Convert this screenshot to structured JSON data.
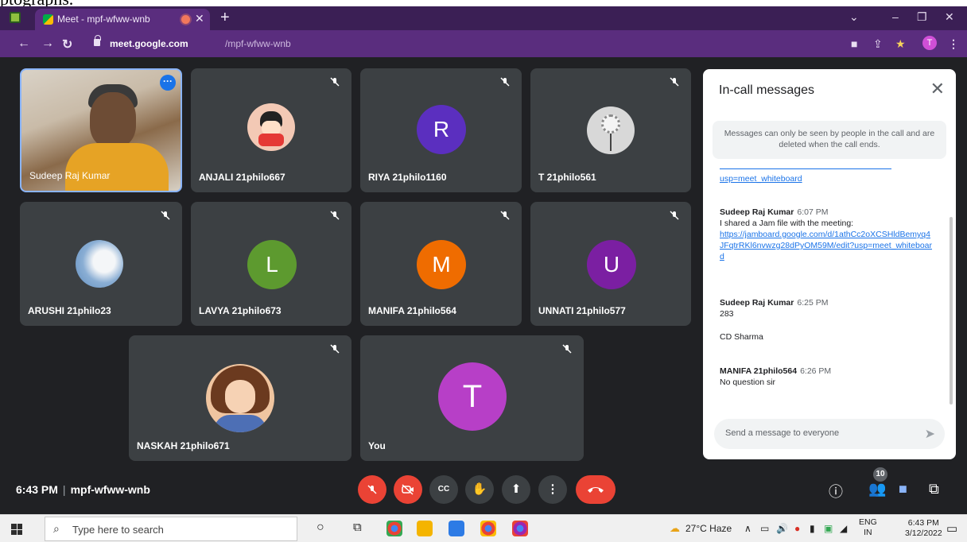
{
  "crop_text": "ptographs.",
  "browser": {
    "tab_title": "Meet - mpf-wfww-wnb",
    "close_glyph": "✕",
    "newtab_glyph": "+",
    "url_domain": "meet.google.com",
    "url_path": "/mpf-wfww-wnb",
    "profile_initial": "T"
  },
  "speaker": {
    "name": "Sudeep Raj Kumar"
  },
  "participants": [
    {
      "name": "ANJALI 21philo667",
      "avatar_type": "image"
    },
    {
      "name": "RIYA 21philo1160",
      "initial": "R",
      "color": "#5b2fbf"
    },
    {
      "name": "T 21philo561",
      "avatar_type": "image"
    },
    {
      "name": "ARUSHI 21philo23",
      "avatar_type": "image"
    },
    {
      "name": "LAVYA 21philo673",
      "initial": "L",
      "color": "#5d9a2f"
    },
    {
      "name": "MANIFA 21philo564",
      "initial": "M",
      "color": "#ef6c00"
    },
    {
      "name": "UNNATI 21philo577",
      "initial": "U",
      "color": "#7b1fa2"
    },
    {
      "name": "NASKAH 21philo671",
      "avatar_type": "image"
    },
    {
      "name": "You",
      "initial": "T",
      "color": "#b73fc7"
    }
  ],
  "panel": {
    "title": "In-call messages",
    "close_glyph": "✕",
    "notice": "Messages can only be seen by people in the call and are deleted when the call ends.",
    "partial_link": "usp=meet_whiteboard",
    "messages": [
      {
        "sender": "Sudeep Raj Kumar",
        "time": "6:07 PM",
        "text": "I shared a Jam file with the meeting:",
        "link": "https://jamboard.google.com/d/1athCc2oXCSHldBemyq4JFqtrRKl6nvwzg28dPyOM59M/edit?usp=meet_whiteboard"
      },
      {
        "sender": "Sudeep Raj Kumar",
        "time": "6:25 PM",
        "text": "283"
      },
      {
        "text": "CD Sharma"
      },
      {
        "sender": "MANIFA 21philo564",
        "time": "6:26 PM",
        "text": "No question sir"
      }
    ],
    "composer_placeholder": "Send a message to everyone"
  },
  "bottom": {
    "time": "6:43 PM",
    "separator": "|",
    "meeting_code": "mpf-wfww-wnb",
    "participant_count": "10"
  },
  "taskbar": {
    "search_placeholder": "Type here to search",
    "weather": "27°C  Haze",
    "lang_top": "ENG",
    "lang_bottom": "IN",
    "clock_time": "6:43 PM",
    "clock_date": "3/12/2022"
  },
  "colors": {
    "meet_bg": "#202124",
    "tile_bg": "#3c4043",
    "hangup": "#ea4335",
    "accent": "#1a73e8",
    "browser_frame": "#5a2d7e"
  }
}
